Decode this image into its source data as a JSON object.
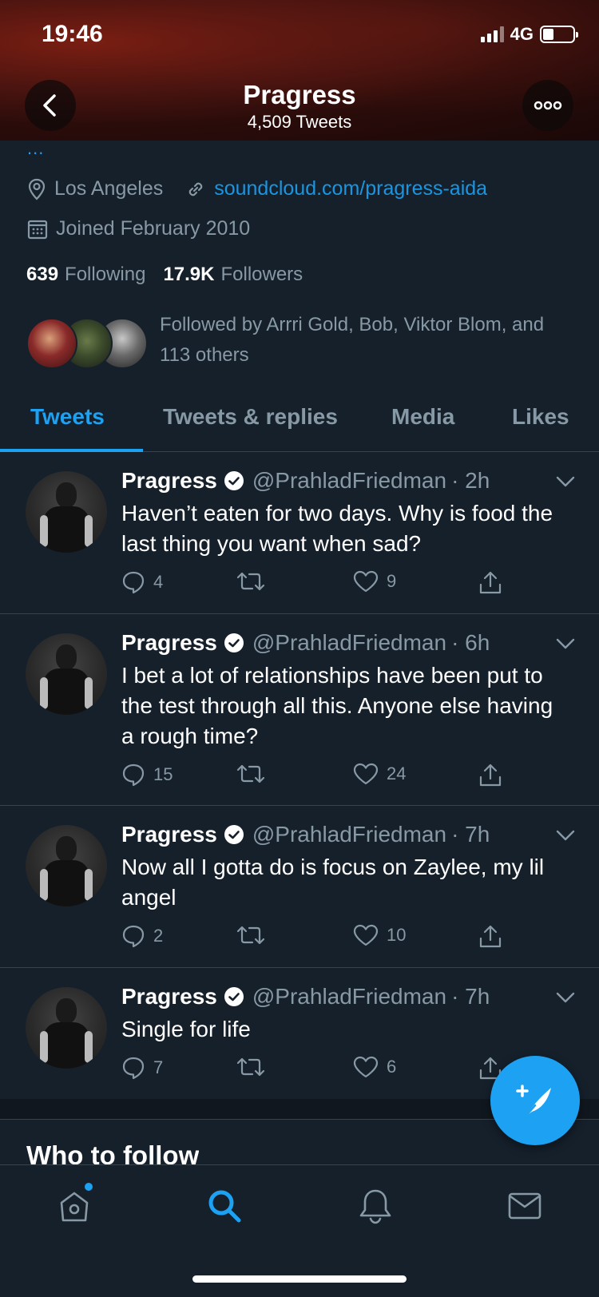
{
  "status_bar": {
    "time": "19:46",
    "network": "4G",
    "battery_level": 0.35
  },
  "header": {
    "name": "Pragress",
    "tweet_count": "4,509 Tweets"
  },
  "profile": {
    "bio_more": "...",
    "location": "Los Angeles",
    "website": "soundcloud.com/pragress-aida",
    "joined": "Joined February 2010",
    "following_count": "639",
    "following_label": "Following",
    "followers_count": "17.9K",
    "followers_label": "Followers",
    "followed_by": "Followed by Arrri Gold, Bob, Viktor Blom, and 113 others"
  },
  "tabs": [
    {
      "label": "Tweets",
      "active": true
    },
    {
      "label": "Tweets & replies",
      "active": false
    },
    {
      "label": "Media",
      "active": false
    },
    {
      "label": "Likes",
      "active": false
    }
  ],
  "tweets": [
    {
      "name": "Pragress",
      "handle": "@PrahladFriedman",
      "time": "· 2h",
      "text": "Haven’t eaten for two days. Why is food the last thing you want when sad?",
      "replies": "4",
      "retweets": "",
      "likes": "9"
    },
    {
      "name": "Pragress",
      "handle": "@PrahladFriedman",
      "time": "· 6h",
      "text": "I bet a lot of relationships have been put to the test through all this. Anyone else having a rough time?",
      "replies": "15",
      "retweets": "",
      "likes": "24"
    },
    {
      "name": "Pragress",
      "handle": "@PrahladFriedman",
      "time": "· 7h",
      "text": "Now all I gotta do is focus on Zaylee, my lil angel",
      "replies": "2",
      "retweets": "",
      "likes": "10"
    },
    {
      "name": "Pragress",
      "handle": "@PrahladFriedman",
      "time": "· 7h",
      "text": "Single for life",
      "replies": "7",
      "retweets": "",
      "likes": "6"
    }
  ],
  "who_to_follow": {
    "title": "Who to follow"
  },
  "colors": {
    "accent": "#1da1f2",
    "background": "#15202b",
    "muted": "#8899a6",
    "border": "#38444d"
  },
  "nav": [
    "home-icon",
    "search-icon",
    "notifications-icon",
    "messages-icon"
  ]
}
